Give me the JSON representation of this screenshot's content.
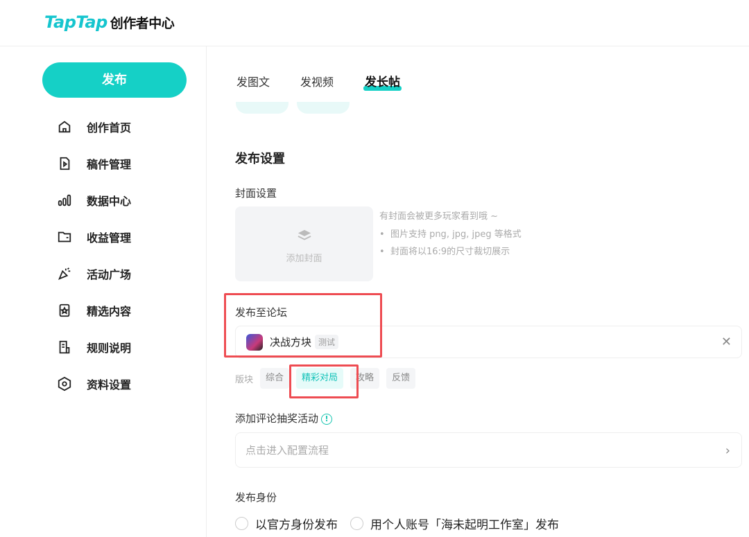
{
  "header": {
    "logo_main": "TapTap",
    "logo_sub": "创作者中心"
  },
  "sidebar": {
    "publish_label": "发布",
    "items": [
      {
        "label": "创作首页",
        "icon": "home-icon"
      },
      {
        "label": "稿件管理",
        "icon": "document-icon"
      },
      {
        "label": "数据中心",
        "icon": "bar-chart-icon"
      },
      {
        "label": "收益管理",
        "icon": "wallet-icon"
      },
      {
        "label": "活动广场",
        "icon": "party-icon"
      },
      {
        "label": "精选内容",
        "icon": "badge-icon"
      },
      {
        "label": "规则说明",
        "icon": "rules-icon"
      },
      {
        "label": "资料设置",
        "icon": "settings-icon"
      }
    ]
  },
  "tabs": [
    "发图文",
    "发视频",
    "发长帖"
  ],
  "settings": {
    "title": "发布设置",
    "cover_label": "封面设置",
    "cover_button": "添加封面",
    "cover_hint": "有封面会被更多玩家看到哦 ~",
    "cover_rules": [
      "图片支持 png, jpg, jpeg 等格式",
      "封面将以16:9的尺寸裁切展示"
    ],
    "forum_label": "发布至论坛",
    "forum_name": "决战方块",
    "forum_tag": "测试",
    "board_label": "版块",
    "boards": [
      "综合",
      "精彩对局",
      "攻略",
      "反馈"
    ],
    "active_board": "精彩对局",
    "lottery_label": "添加评论抽奖活动",
    "lottery_placeholder": "点击进入配置流程",
    "identity_label": "发布身份",
    "identity_options": [
      "以官方身份发布",
      "用个人账号「海未起明工作室」发布"
    ]
  },
  "colors": {
    "accent": "#15d0c6",
    "highlight": "#ee4c52"
  }
}
